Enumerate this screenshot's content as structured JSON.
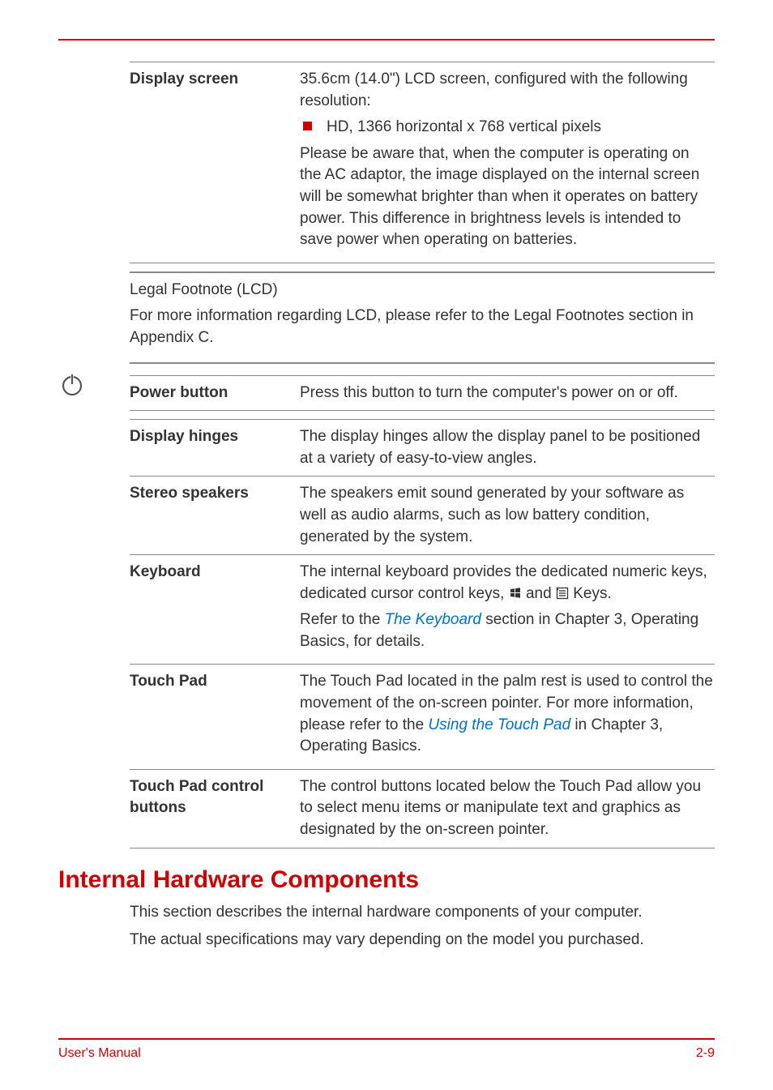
{
  "rows1": {
    "display_screen": {
      "term": "Display screen",
      "p1": "35.6cm (14.0\") LCD screen, configured with the following resolution:",
      "bullet1": "HD, 1366 horizontal x 768 vertical pixels",
      "p2": "Please be aware that, when the computer is operating on the AC adaptor, the image displayed on the internal screen will be somewhat brighter than when it operates on battery power. This difference in brightness levels is intended to save power when operating on batteries."
    }
  },
  "legal": {
    "title": "Legal Footnote (LCD)",
    "body": "For more information regarding LCD, please refer to the Legal Footnotes section in Appendix C."
  },
  "rows2": {
    "power_button": {
      "term": "Power button",
      "desc": "Press this button to turn the computer's power on or off."
    },
    "display_hinges": {
      "term": "Display hinges",
      "desc": "The display hinges allow the display panel to be positioned at a variety of easy-to-view angles."
    },
    "stereo_speakers": {
      "term": "Stereo speakers",
      "desc": "The speakers emit sound generated by your software as well as audio alarms, such as low battery condition, generated by the system."
    },
    "keyboard": {
      "term": "Keyboard",
      "p1a": "The internal keyboard provides the dedicated numeric keys, dedicated cursor control keys, ",
      "p1b": " and ",
      "p1c": " Keys.",
      "p2a": "Refer to the ",
      "p2link": "The Keyboard",
      "p2b": " section in Chapter 3, Operating Basics, for details."
    },
    "touch_pad": {
      "term": "Touch Pad",
      "p_a": "The Touch Pad located in the palm rest is used to control the movement of the on-screen pointer. For more information, please refer to the ",
      "p_link": "Using the Touch Pad",
      "p_b": " in Chapter 3, Operating Basics."
    },
    "touch_pad_ctrl": {
      "term": "Touch Pad control buttons",
      "desc": "The control buttons located below the Touch Pad allow you to select menu items or manipulate text and graphics as designated by the on-screen pointer."
    }
  },
  "section": {
    "title": "Internal Hardware Components",
    "p1": "This section describes the internal hardware components of your computer.",
    "p2": "The actual specifications may vary depending on the model you purchased."
  },
  "footer": {
    "left": "User's Manual",
    "right": "2-9"
  }
}
